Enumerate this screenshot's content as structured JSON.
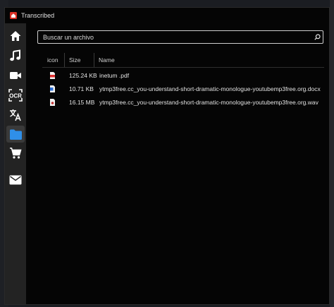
{
  "window": {
    "title": "Transcribed"
  },
  "sidebar": {
    "items": [
      {
        "name": "home",
        "icon": "home-icon",
        "active": false
      },
      {
        "name": "music",
        "icon": "music-note-icon",
        "active": false
      },
      {
        "name": "video",
        "icon": "video-camera-icon",
        "active": false
      },
      {
        "name": "ocr",
        "icon": "ocr-icon",
        "active": false
      },
      {
        "name": "translate",
        "icon": "translate-icon",
        "active": false
      },
      {
        "name": "files",
        "icon": "folder-icon",
        "active": true
      },
      {
        "name": "shop",
        "icon": "shopping-cart-icon",
        "active": false
      },
      {
        "name": "mail",
        "icon": "mail-icon",
        "active": false
      }
    ]
  },
  "search": {
    "placeholder": "Buscar un archivo",
    "icon": "search-icon"
  },
  "table": {
    "headers": {
      "icon": "icon",
      "size": "Size",
      "name": "Name"
    },
    "rows": [
      {
        "type": "pdf",
        "icon": "pdf-file-icon",
        "size": "125.24 KB",
        "name": "inetum .pdf"
      },
      {
        "type": "docx",
        "icon": "word-file-icon",
        "size": "10.71 KB",
        "name": "ytmp3free.cc_you-understand-short-dramatic-monologue-youtubemp3free.org.docx"
      },
      {
        "type": "wav",
        "icon": "audio-file-icon",
        "size": "16.15 MB",
        "name": "ytmp3free.cc_you-understand-short-dramatic-monologue-youtubemp3free.org.wav"
      }
    ]
  },
  "colors": {
    "window_bg": "#050505",
    "sidebar_bg": "#232323",
    "active_item_bg": "#3a3a3a",
    "folder_accent": "#2f8fe8",
    "pdf_red": "#e03030",
    "word_blue": "#2b6fd6"
  }
}
